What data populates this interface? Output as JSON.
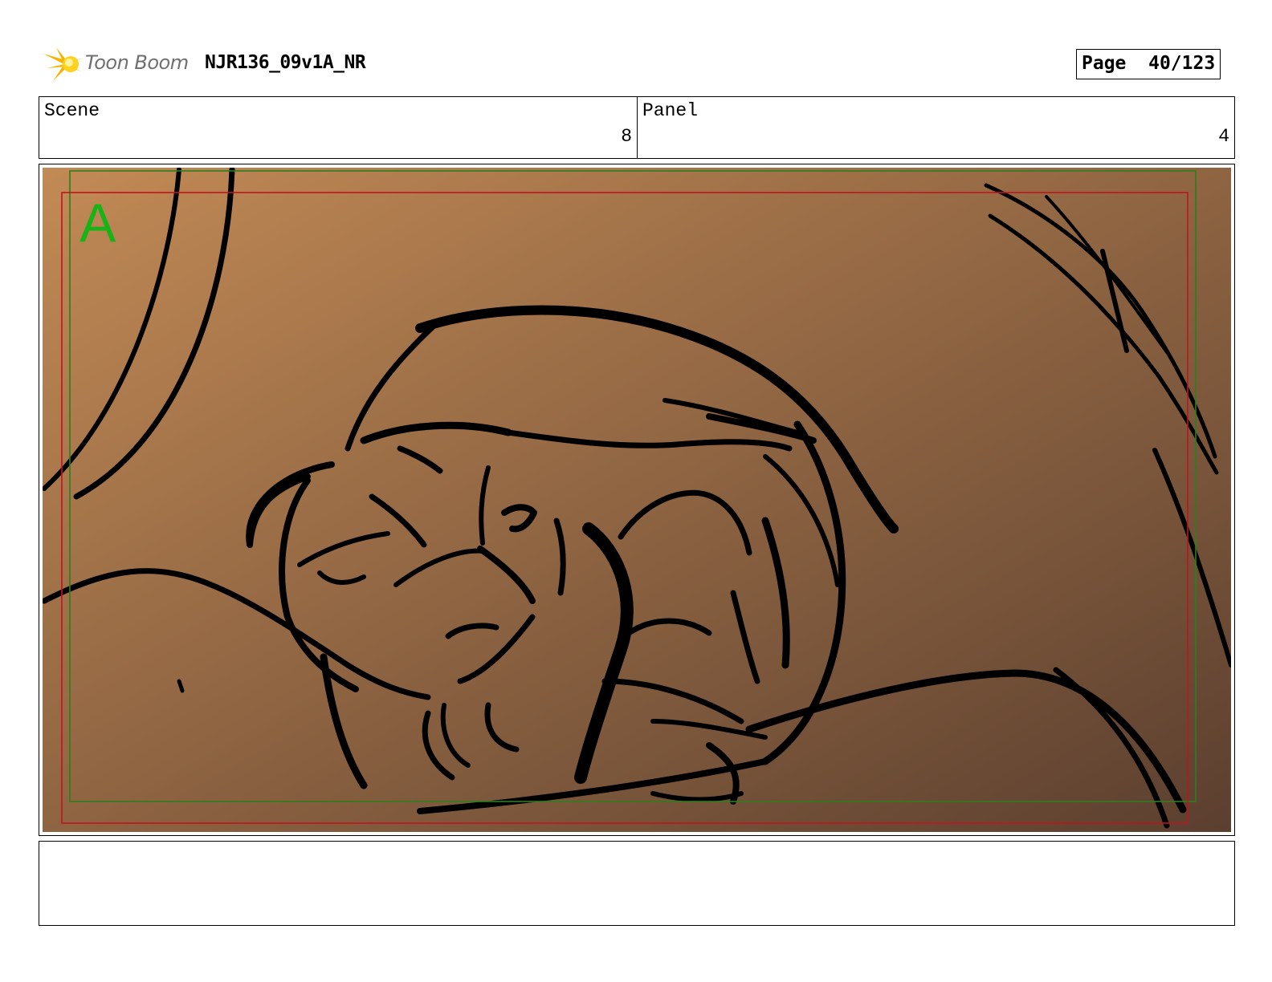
{
  "header": {
    "logo_text": "Toon Boom",
    "project_title": "NJR136_09v1A_NR",
    "page_label": "Page",
    "page_value": "40/123"
  },
  "info": {
    "scene_label": "Scene",
    "scene_value": "8",
    "panel_label": "Panel",
    "panel_value": "4"
  },
  "panel": {
    "safe_area_letter": "A",
    "colors": {
      "bg_light": "#c28a55",
      "bg_dark": "#5b3f2f",
      "safe_frame": "#2e7d1e",
      "action_frame": "#c0141e",
      "letter": "#17b317",
      "ink": "#000000"
    }
  },
  "notes": {
    "text": ""
  }
}
